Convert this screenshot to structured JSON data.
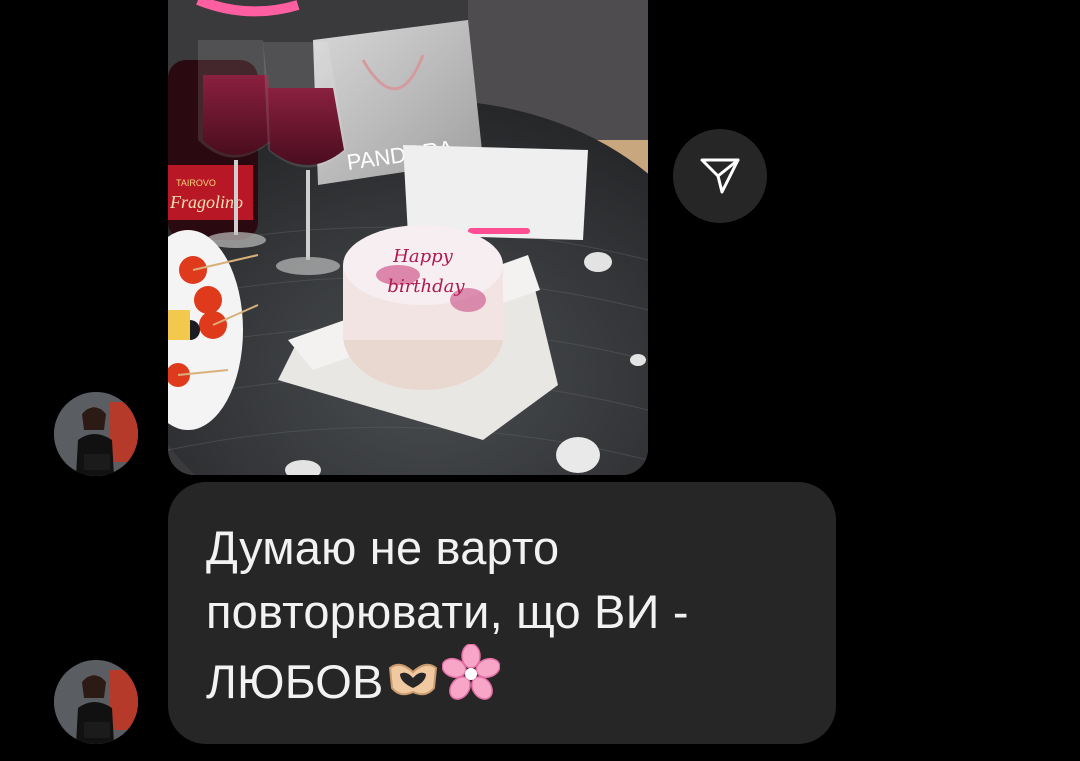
{
  "conversation": {
    "photo_message": {
      "alt": "Photo of a bento birthday cake with pink drinks and a PANDORA gift bag",
      "cake_text_line1": "Happy",
      "cake_text_line2": "birthday",
      "bag_brand": "PANDORA",
      "bottle_brand": "TAIROVO",
      "bottle_label": "Fragolino",
      "share_icon": "paper-plane-icon"
    },
    "text_message": {
      "line1": "Думаю не варто",
      "line2": "повторювати, що ВИ -",
      "line3": "ЛЮБОВ",
      "emojis": [
        "heart-hands-icon",
        "cherry-blossom-icon"
      ]
    },
    "avatar_icon": "user-avatar-icon"
  },
  "colors": {
    "background": "#000000",
    "bubble": "#262626",
    "text": "#f2f2f2",
    "share_button": "#262626"
  }
}
